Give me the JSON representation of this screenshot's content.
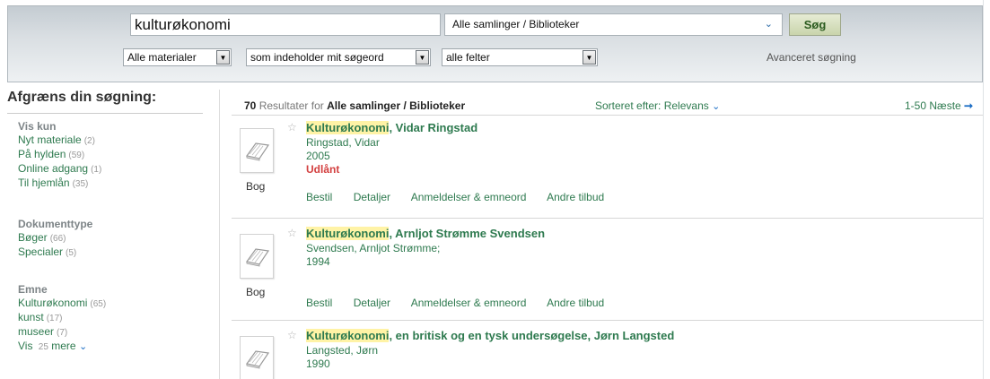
{
  "search": {
    "query": "kulturøkonomi",
    "collection": "Alle samlinger / Biblioteker",
    "button": "Søg",
    "material_type": "Alle materialer",
    "match_mode": "som indeholder mit søgeord",
    "field": "alle felter",
    "advanced": "Avanceret søgning"
  },
  "facets": {
    "title": "Afgræns din søgning:",
    "groups": [
      {
        "label": "Vis kun",
        "items": [
          {
            "label": "Nyt materiale",
            "count": "(2)"
          },
          {
            "label": "På hylden",
            "count": "(59)"
          },
          {
            "label": "Online adgang",
            "count": "(1)"
          },
          {
            "label": "Til hjemlån",
            "count": "(35)"
          }
        ]
      },
      {
        "label": "Dokumenttype",
        "items": [
          {
            "label": "Bøger",
            "count": "(66)"
          },
          {
            "label": "Specialer",
            "count": "(5)"
          }
        ]
      },
      {
        "label": "Emne",
        "items": [
          {
            "label": "Kulturøkonomi",
            "count": "(65)"
          },
          {
            "label": "kunst",
            "count": "(17)"
          },
          {
            "label": "museer",
            "count": "(7)"
          }
        ],
        "more": {
          "pre": "Vis",
          "count": "25",
          "post": "mere"
        }
      }
    ]
  },
  "results": {
    "count": "70",
    "for_label": "Resultater for",
    "scope": "Alle samlinger / Biblioteker",
    "sort_label": "Sorteret efter:",
    "sort_value": "Relevans",
    "paging": "1-50 Næste",
    "items": [
      {
        "title_hl": "Kulturøkonomi",
        "title_rest": ", Vidar Ringstad",
        "author": "Ringstad, Vidar",
        "year": "2005",
        "status": "Udlånt",
        "type": "Bog"
      },
      {
        "title_hl": "Kulturøkonomi",
        "title_rest": ", Arnljot Strømme Svendsen",
        "author": "Svendsen, Arnljot Strømme;",
        "year": "1994",
        "status": "",
        "type": "Bog"
      },
      {
        "title_hl": "Kulturøkonomi",
        "title_rest": ", en britisk og en tysk undersøgelse, Jørn Langsted",
        "author": "Langsted, Jørn",
        "year": "1990",
        "status": "",
        "type": ""
      }
    ],
    "actions": [
      "Bestil",
      "Detaljer",
      "Anmeldelser & emneord",
      "Andre tilbud"
    ]
  }
}
